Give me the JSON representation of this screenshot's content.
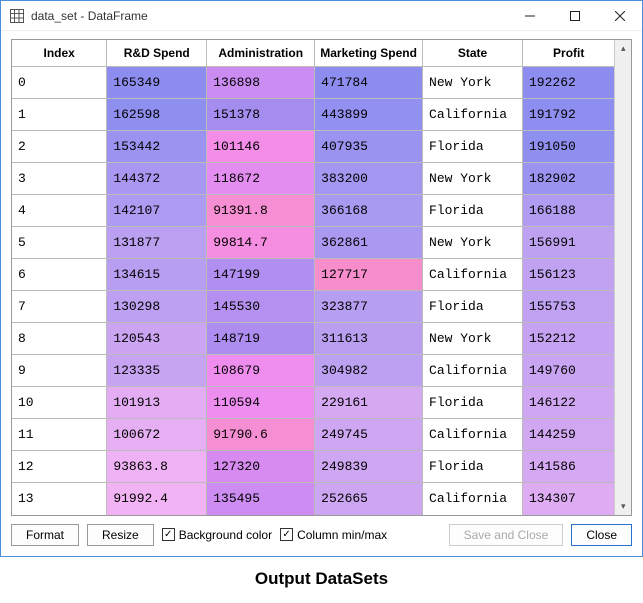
{
  "window": {
    "title": "data_set - DataFrame"
  },
  "columns": [
    "Index",
    "R&D Spend",
    "Administration",
    "Marketing Spend",
    "State",
    "Profit"
  ],
  "rows": [
    {
      "idx": "0",
      "rd": "165349",
      "rdC": "#8d8df0",
      "adm": "136898",
      "admC": "#cb8cf2",
      "mkt": "471784",
      "mktC": "#8d8df0",
      "st": "New York",
      "pf": "192262",
      "pfC": "#8d8df0"
    },
    {
      "idx": "1",
      "rd": "162598",
      "rdC": "#8f8ff0",
      "adm": "151378",
      "admC": "#a58df0",
      "mkt": "443899",
      "mktC": "#9290f0",
      "st": "California",
      "pf": "191792",
      "pfC": "#8e8ef0"
    },
    {
      "idx": "2",
      "rd": "153442",
      "rdC": "#9c93f0",
      "adm": "101146",
      "admC": "#f38de8",
      "mkt": "407935",
      "mktC": "#9a93f0",
      "st": "Florida",
      "pf": "191050",
      "pfC": "#8f8ff0"
    },
    {
      "idx": "3",
      "rd": "144372",
      "rdC": "#a998f1",
      "adm": "118672",
      "admC": "#e48df0",
      "mkt": "383200",
      "mktC": "#a397f1",
      "st": "New York",
      "pf": "182902",
      "pfC": "#9b93f0"
    },
    {
      "idx": "4",
      "rd": "142107",
      "rdC": "#ad9af1",
      "adm": "91391.8",
      "admC": "#f68ed3",
      "mkt": "366168",
      "mktC": "#a899f1",
      "st": "Florida",
      "pf": "166188",
      "pfC": "#b29cf1"
    },
    {
      "idx": "5",
      "rd": "131877",
      "rdC": "#bb9ff1",
      "adm": "99814.7",
      "admC": "#f58de1",
      "mkt": "362861",
      "mktC": "#aa99f1",
      "st": "New York",
      "pf": "156991",
      "pfC": "#bfa1f1"
    },
    {
      "idx": "6",
      "rd": "134615",
      "rdC": "#b79ef1",
      "adm": "147199",
      "admC": "#b18ff0",
      "mkt": "127717",
      "mktC": "#f78ecb",
      "st": "California",
      "pf": "156123",
      "pfC": "#c0a1f2"
    },
    {
      "idx": "7",
      "rd": "130298",
      "rdC": "#bda0f1",
      "adm": "145530",
      "admC": "#b590f0",
      "mkt": "323877",
      "mktC": "#b69ef1",
      "st": "Florida",
      "pf": "155753",
      "pfC": "#c1a2f2"
    },
    {
      "idx": "8",
      "rd": "120543",
      "rdC": "#cba5f2",
      "adm": "148719",
      "admC": "#ad8ef0",
      "mkt": "311613",
      "mktC": "#ba9ff1",
      "st": "New York",
      "pf": "152212",
      "pfC": "#c6a3f2"
    },
    {
      "idx": "9",
      "rd": "123335",
      "rdC": "#c7a4f2",
      "adm": "108679",
      "admC": "#ef8def",
      "mkt": "304982",
      "mktC": "#bca0f1",
      "st": "California",
      "pf": "149760",
      "pfC": "#c9a4f2"
    },
    {
      "idx": "10",
      "rd": "101913",
      "rdC": "#e4adf3",
      "adm": "110594",
      "admC": "#ed8df0",
      "mkt": "229161",
      "mktC": "#d5a9f2",
      "st": "Florida",
      "pf": "146122",
      "pfC": "#cea6f2"
    },
    {
      "idx": "11",
      "rd": "100672",
      "rdC": "#e6aef3",
      "adm": "91790.6",
      "admC": "#f68ed4",
      "mkt": "249745",
      "mktC": "#cea6f2",
      "st": "California",
      "pf": "144259",
      "pfC": "#d1a7f2"
    },
    {
      "idx": "12",
      "rd": "93863.8",
      "rdC": "#efb2f4",
      "adm": "127320",
      "admC": "#d78bf1",
      "mkt": "249839",
      "mktC": "#cea6f2",
      "st": "Florida",
      "pf": "141586",
      "pfC": "#d4a8f2"
    },
    {
      "idx": "13",
      "rd": "91992.4",
      "rdC": "#f1b3f4",
      "adm": "135495",
      "admC": "#cd8cf2",
      "mkt": "252665",
      "mktC": "#cda6f2",
      "st": "California",
      "pf": "134307",
      "pfC": "#deacf3"
    }
  ],
  "footer": {
    "format": "Format",
    "resize": "Resize",
    "bgcolor": "Background color",
    "minmax": "Column min/max",
    "save": "Save and Close",
    "close": "Close"
  },
  "caption": "Output DataSets"
}
